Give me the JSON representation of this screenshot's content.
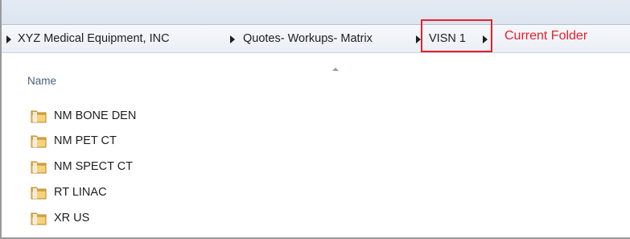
{
  "breadcrumb": {
    "items": [
      {
        "label": "XYZ Medical Equipment, INC"
      },
      {
        "label": "Quotes- Workups- Matrix"
      },
      {
        "label": "VISN 1"
      }
    ]
  },
  "annotation": {
    "label": "Current Folder",
    "color": "#e8202c"
  },
  "list": {
    "column_header": "Name",
    "sort_icon": "sort-ascending-icon",
    "folder_icon": "folder-icon",
    "items": [
      {
        "name": "NM BONE DEN"
      },
      {
        "name": "NM PET CT"
      },
      {
        "name": "NM SPECT CT"
      },
      {
        "name": "RT LINAC"
      },
      {
        "name": "XR US"
      }
    ]
  }
}
